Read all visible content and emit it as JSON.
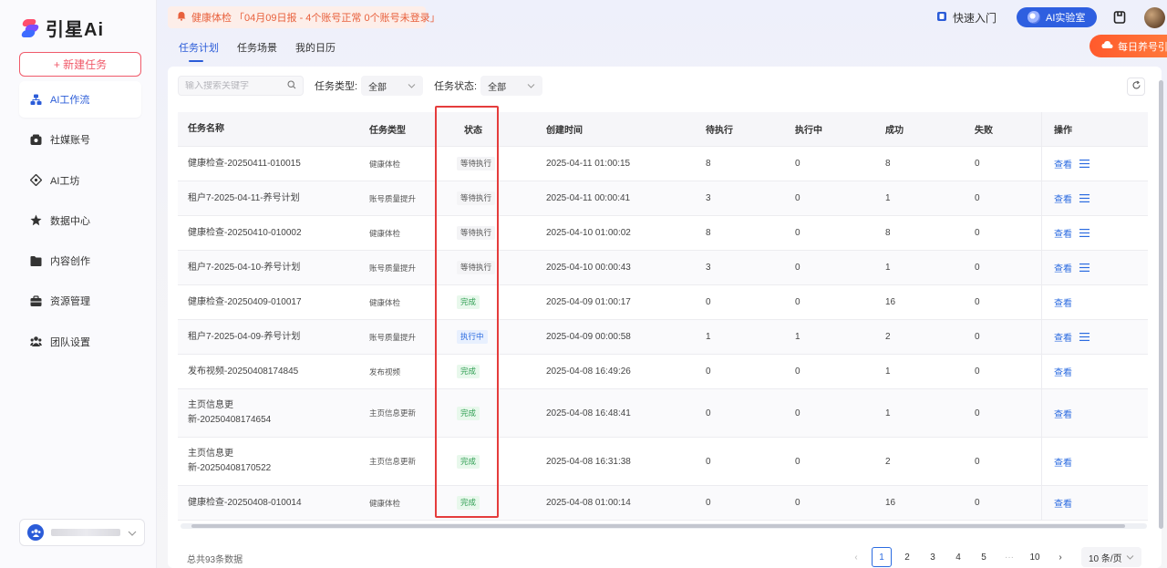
{
  "app": {
    "logo_text": "引星Ai",
    "brand_color": "#2b5cd8"
  },
  "sidebar": {
    "new_task_label": "+ 新建任务",
    "items": [
      {
        "label": "AI工作流",
        "icon": "workflow-icon",
        "active": true
      },
      {
        "label": "社媒账号",
        "icon": "account-icon"
      },
      {
        "label": "AI工坊",
        "icon": "ai-workshop-icon"
      },
      {
        "label": "数据中心",
        "icon": "data-center-icon"
      },
      {
        "label": "内容创作",
        "icon": "folder-icon"
      },
      {
        "label": "资源管理",
        "icon": "briefcase-icon"
      },
      {
        "label": "团队设置",
        "icon": "team-icon"
      }
    ]
  },
  "header": {
    "notice_text": "健康体检 「04月09日报 - 4个账号正常 0个账号未登录」",
    "quick_entry_label": "快速入门",
    "ai_lab_label": "AI实验室",
    "daily_label": "每日养号引流"
  },
  "tabs": [
    {
      "label": "任务计划",
      "active": true
    },
    {
      "label": "任务场景"
    },
    {
      "label": "我的日历"
    }
  ],
  "filters": {
    "search_placeholder": "输入搜索关键字",
    "type_label": "任务类型:",
    "type_value": "全部",
    "status_label": "任务状态:",
    "status_value": "全部"
  },
  "table": {
    "columns": [
      "任务名称",
      "任务类型",
      "状态",
      "创建时间",
      "待执行",
      "执行中",
      "成功",
      "失败",
      "操作"
    ],
    "view_label": "查看",
    "rows": [
      {
        "name": "健康检查-20250411-010015",
        "type": "健康体检",
        "status": "等待执行",
        "status_kind": "wait",
        "created": "2025-04-11 01:00:15",
        "pending": "8",
        "running": "0",
        "success": "8",
        "failed": "0",
        "menu": true,
        "h": 38
      },
      {
        "name": "租户7-2025-04-11-养号计划",
        "type": "账号质量提升",
        "status": "等待执行",
        "status_kind": "wait",
        "created": "2025-04-11 00:00:41",
        "pending": "3",
        "running": "0",
        "success": "1",
        "failed": "0",
        "menu": true,
        "h": 38
      },
      {
        "name": "健康检查-20250410-010002",
        "type": "健康体检",
        "status": "等待执行",
        "status_kind": "wait",
        "created": "2025-04-10 01:00:02",
        "pending": "8",
        "running": "0",
        "success": "8",
        "failed": "0",
        "menu": true,
        "h": 38
      },
      {
        "name": "租户7-2025-04-10-养号计划",
        "type": "账号质量提升",
        "status": "等待执行",
        "status_kind": "wait",
        "created": "2025-04-10 00:00:43",
        "pending": "3",
        "running": "0",
        "success": "1",
        "failed": "0",
        "menu": true,
        "h": 38
      },
      {
        "name": "健康检查-20250409-010017",
        "type": "健康体检",
        "status": "完成",
        "status_kind": "done",
        "created": "2025-04-09 01:00:17",
        "pending": "0",
        "running": "0",
        "success": "16",
        "failed": "0",
        "menu": false,
        "h": 38
      },
      {
        "name": "租户7-2025-04-09-养号计划",
        "type": "账号质量提升",
        "status": "执行中",
        "status_kind": "run",
        "created": "2025-04-09 00:00:58",
        "pending": "1",
        "running": "1",
        "success": "2",
        "failed": "0",
        "menu": true,
        "h": 38
      },
      {
        "name": "发布视频-20250408174845",
        "type": "发布视频",
        "status": "完成",
        "status_kind": "done",
        "created": "2025-04-08 16:49:26",
        "pending": "0",
        "running": "0",
        "success": "1",
        "failed": "0",
        "menu": false,
        "h": 38
      },
      {
        "name": "主页信息更\n新-20250408174654",
        "type": "主页信息更新",
        "status": "完成",
        "status_kind": "done",
        "created": "2025-04-08 16:48:41",
        "pending": "0",
        "running": "0",
        "success": "1",
        "failed": "0",
        "menu": false,
        "h": 53
      },
      {
        "name": "主页信息更\n新-20250408170522",
        "type": "主页信息更新",
        "status": "完成",
        "status_kind": "done",
        "created": "2025-04-08 16:31:38",
        "pending": "0",
        "running": "0",
        "success": "2",
        "failed": "0",
        "menu": false,
        "h": 53
      },
      {
        "name": "健康检查-20250408-010014",
        "type": "健康体检",
        "status": "完成",
        "status_kind": "done",
        "created": "2025-04-08 01:00:14",
        "pending": "0",
        "running": "0",
        "success": "16",
        "failed": "0",
        "menu": false,
        "h": 38
      }
    ]
  },
  "pagination": {
    "total_text": "总共93条数据",
    "prev": "‹",
    "pages": [
      "1",
      "2",
      "3",
      "4",
      "5"
    ],
    "ellipsis": "···",
    "last": "10",
    "next": "›",
    "page_size": "10 条/页"
  }
}
